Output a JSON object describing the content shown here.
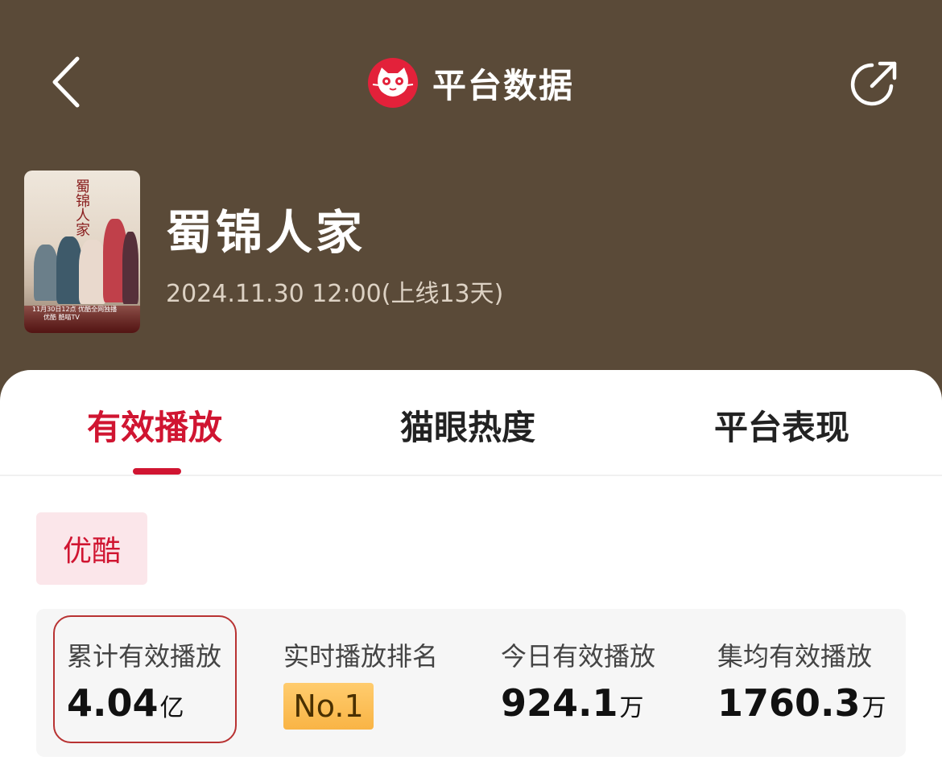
{
  "header": {
    "title": "平台数据",
    "back_icon": "chevron-left-icon",
    "share_icon": "share-icon",
    "logo_icon": "maoyan-cat-logo-icon"
  },
  "show": {
    "title": "蜀锦人家",
    "date": "2024.11.30 12:00(上线13天)",
    "poster": {
      "title": "蜀锦人家",
      "caption": "11月30日12点 优酷全网独播",
      "platforms": "优酷  酷喵TV"
    }
  },
  "tabs": [
    {
      "label": "有效播放",
      "active": true
    },
    {
      "label": "猫眼热度",
      "active": false
    },
    {
      "label": "平台表现",
      "active": false
    }
  ],
  "platform": {
    "selected": "优酷"
  },
  "stats": [
    {
      "label": "累计有效播放",
      "value": "4.04",
      "unit": "亿"
    },
    {
      "label": "实时播放排名",
      "badge": "No.1"
    },
    {
      "label": "今日有效播放",
      "value": "924.1",
      "unit": "万"
    },
    {
      "label": "集均有效播放",
      "value": "1760.3",
      "unit": "万"
    }
  ],
  "colors": {
    "header_bg": "#5a4a38",
    "accent": "#d01531",
    "badge": "#f9b445"
  }
}
